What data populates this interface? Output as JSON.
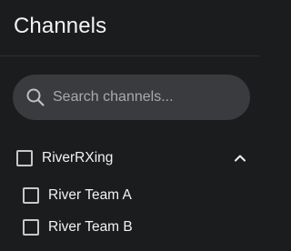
{
  "header": {
    "title": "Channels"
  },
  "search": {
    "placeholder": "Search channels...",
    "value": "",
    "icon": "search-icon"
  },
  "groups": [
    {
      "label": "RiverRXing",
      "checked": false,
      "expanded": true,
      "toggle_icon": "chevron-up-icon",
      "items": [
        {
          "label": "River Team A",
          "checked": false
        },
        {
          "label": "River Team B",
          "checked": false
        }
      ]
    }
  ],
  "colors": {
    "background": "#1b1c1e",
    "search_background": "#3a3b3e",
    "text": "#f2f2f2",
    "placeholder": "#a9aaad",
    "checkbox_border": "#c7c8ca"
  }
}
